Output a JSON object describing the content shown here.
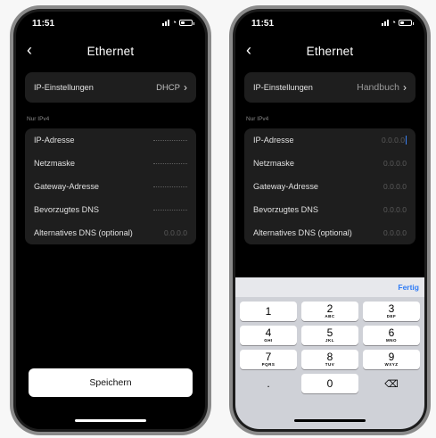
{
  "left": {
    "time": "11:51",
    "title": "Ethernet",
    "ip_settings": {
      "label": "IP-Einstellungen",
      "value": "DHCP"
    },
    "section": "Nur IPv4",
    "fields": [
      {
        "label": "IP-Adresse",
        "value": ""
      },
      {
        "label": "Netzmaske",
        "value": ""
      },
      {
        "label": "Gateway-Adresse",
        "value": ""
      },
      {
        "label": "Bevorzugtes DNS",
        "value": ""
      },
      {
        "label": "Alternatives DNS (optional)",
        "value": "0.0.0.0"
      }
    ],
    "save_label": "Speichern"
  },
  "right": {
    "time": "11:51",
    "title": "Ethernet",
    "ip_settings": {
      "label": "IP-Einstellungen",
      "value": "Handbuch"
    },
    "section": "Nur IPv4",
    "fields": [
      {
        "label": "IP-Adresse",
        "value": "0.0.0.0"
      },
      {
        "label": "Netzmaske",
        "value": "0.0.0.0"
      },
      {
        "label": "Gateway-Adresse",
        "value": "0.0.0.0"
      },
      {
        "label": "Bevorzugtes DNS",
        "value": "0.0.0.0"
      },
      {
        "label": "Alternatives DNS (optional)",
        "value": "0.0.0.0"
      }
    ],
    "keyboard": {
      "done_label": "Fertig",
      "keys": [
        {
          "num": "1",
          "sub": ""
        },
        {
          "num": "2",
          "sub": "ABC"
        },
        {
          "num": "3",
          "sub": "DEF"
        },
        {
          "num": "4",
          "sub": "GHI"
        },
        {
          "num": "5",
          "sub": "JKL"
        },
        {
          "num": "6",
          "sub": "MNO"
        },
        {
          "num": "7",
          "sub": "PQRS"
        },
        {
          "num": "8",
          "sub": "TUV"
        },
        {
          "num": "9",
          "sub": "WXYZ"
        },
        {
          "num": ".",
          "sub": ""
        },
        {
          "num": "0",
          "sub": ""
        }
      ]
    }
  },
  "colors": {
    "accent": "#2f7cf6",
    "background": "#000000",
    "card": "#1e1e1e"
  }
}
